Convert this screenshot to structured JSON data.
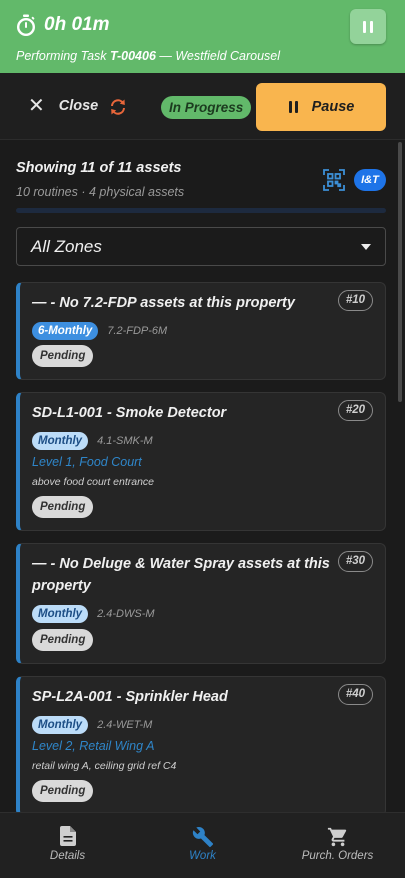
{
  "timer": {
    "elapsed": "0h 01m",
    "task_prefix": "Performing Task",
    "task_id": "T-00406",
    "task_suffix": "— Westfield Carousel"
  },
  "actions": {
    "close_label": "Close",
    "status": "In Progress",
    "pause_label": "Pause"
  },
  "summary": {
    "title": "Showing 11 of 11 assets",
    "subtitle": "10 routines · 4 physical assets",
    "badge": "I&T",
    "progress": 0.0
  },
  "zone_filter": {
    "selected": "All Zones"
  },
  "assets": [
    {
      "title": "— - No 7.2-FDP assets at this property",
      "number": "#10",
      "frequency": "6-Monthly",
      "code": "7.2-FDP-6M",
      "location": "",
      "note": "",
      "status": "Pending"
    },
    {
      "title": "SD-L1-001 - Smoke Detector",
      "number": "#20",
      "frequency": "Monthly",
      "code": "4.1-SMK-M",
      "location": "Level 1, Food Court",
      "note": "above food court entrance",
      "status": "Pending"
    },
    {
      "title": "— - No Deluge & Water Spray assets at this property",
      "number": "#30",
      "frequency": "Monthly",
      "code": "2.4-DWS-M",
      "location": "",
      "note": "",
      "status": "Pending"
    },
    {
      "title": "SP-L2A-001 - Sprinkler Head",
      "number": "#40",
      "frequency": "Monthly",
      "code": "2.4-WET-M",
      "location": "Level 2, Retail Wing A",
      "note": "retail wing A, ceiling grid ref C4",
      "status": "Pending"
    }
  ],
  "nav": {
    "details": "Details",
    "work": "Work",
    "purchase_orders": "Purch. Orders"
  },
  "colors": {
    "timer_bg": "#62b96a",
    "pause_bg": "#f9b54e",
    "accent_blue": "#2e82c7",
    "six_monthly_pill": "#3d8fe0",
    "monthly_pill": "#bcdcf8"
  },
  "icons": [
    "stopwatch-icon",
    "pause-icon",
    "close-icon",
    "sync-icon",
    "qr-scan-icon",
    "chevron-down-icon",
    "document-icon",
    "wrench-icon",
    "cart-icon"
  ]
}
